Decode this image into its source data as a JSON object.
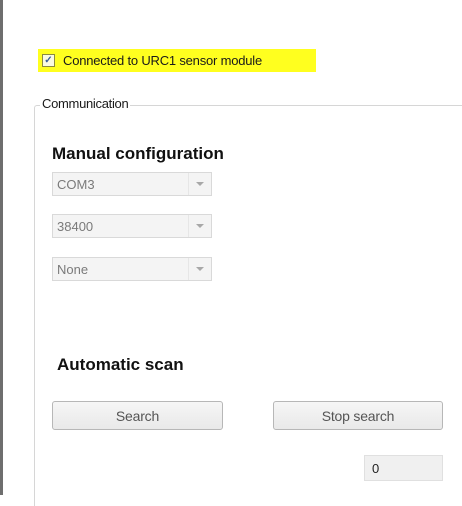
{
  "status": {
    "checked": true,
    "check_glyph": "✓",
    "label": "Connected to URC1 sensor module",
    "highlight_color": "#ffff1f"
  },
  "communication": {
    "legend": "Communication",
    "manual": {
      "title": "Manual configuration",
      "port": "COM3",
      "baud": "38400",
      "parity": "None"
    },
    "automatic": {
      "title": "Automatic scan",
      "search_label": "Search",
      "stop_label": "Stop search",
      "count": "0"
    }
  }
}
